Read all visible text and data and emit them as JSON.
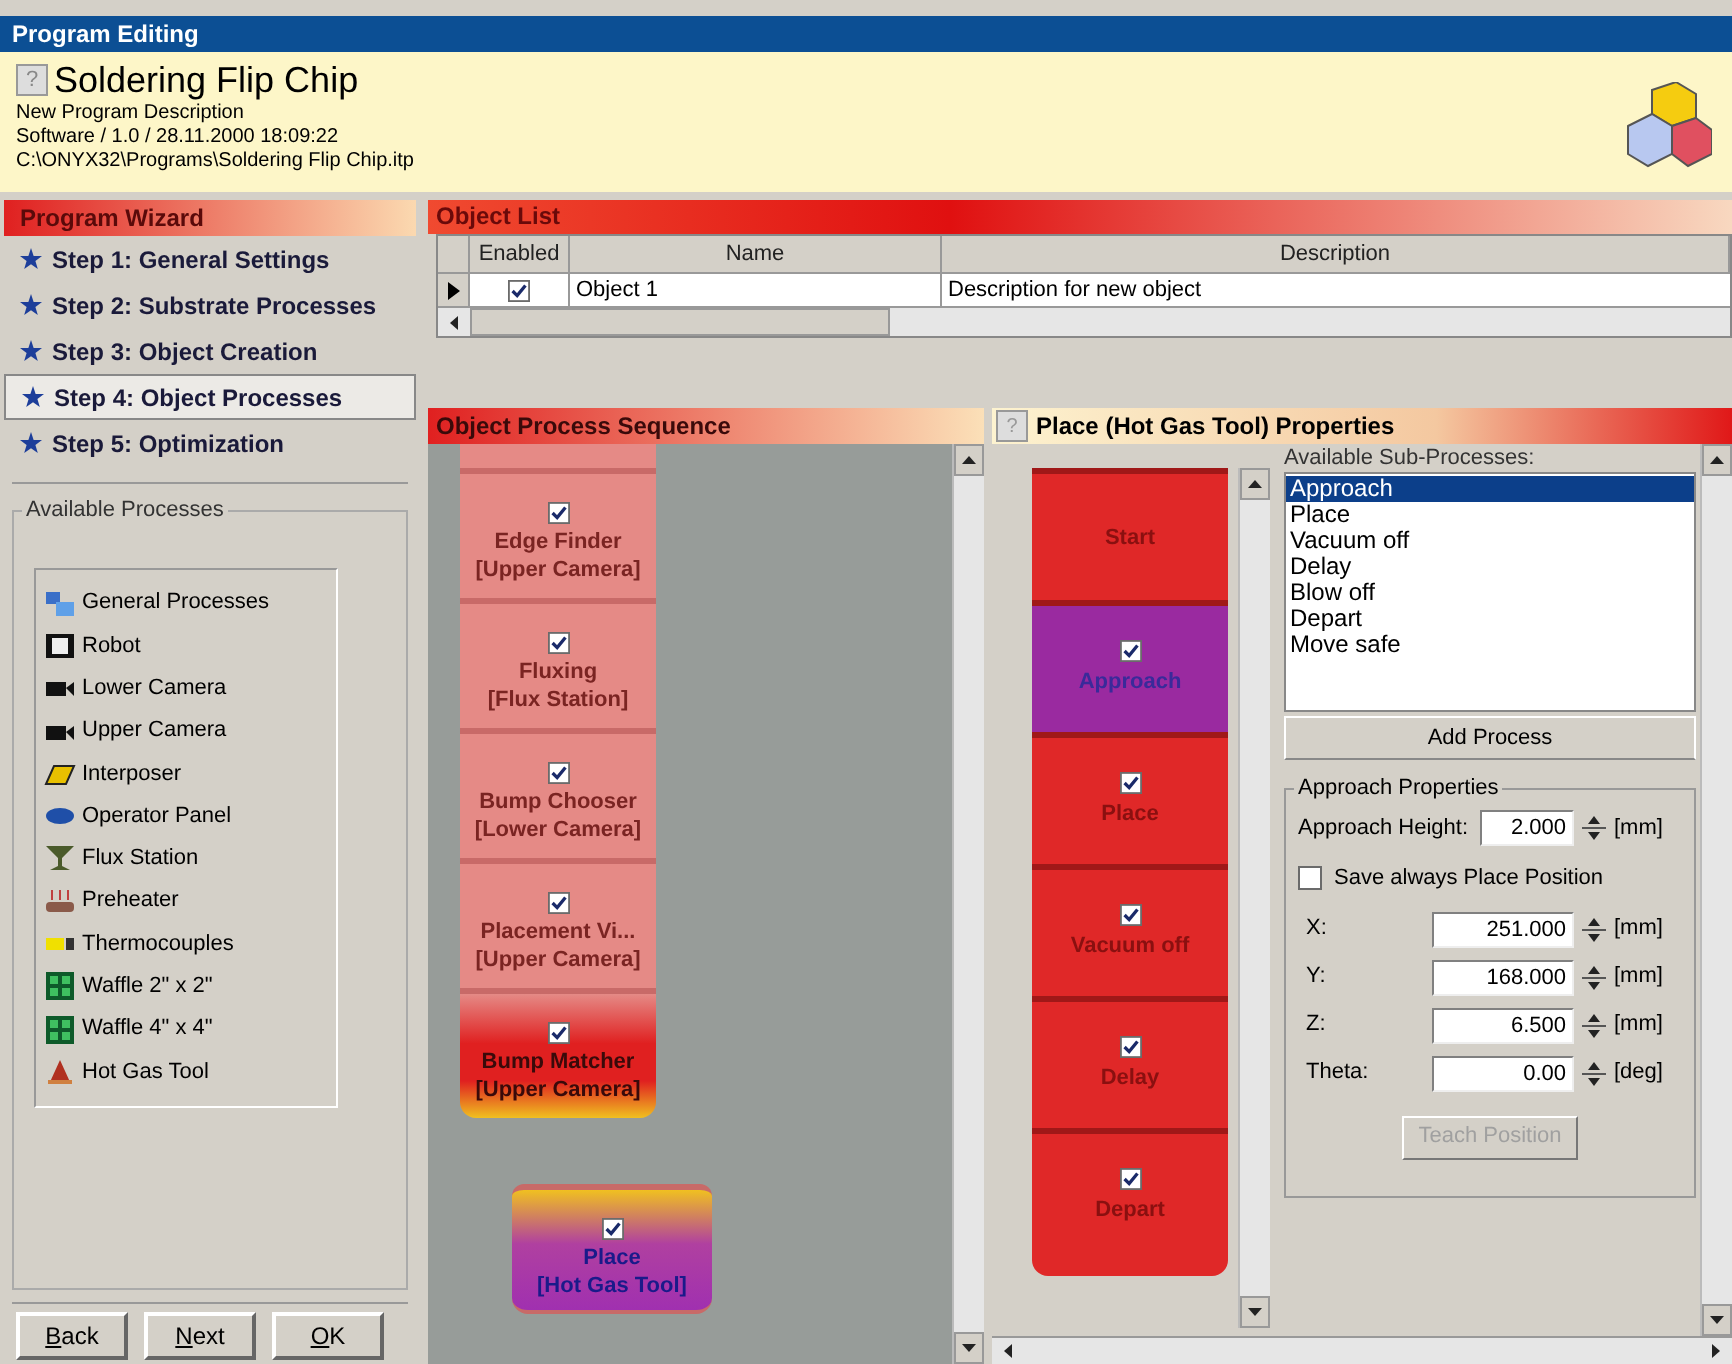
{
  "window": {
    "title": "Program Editing"
  },
  "header": {
    "help_label": "?",
    "title": "Soldering Flip Chip",
    "lines": [
      "New Program Description",
      "Software / 1.0 / 28.11.2000 18:09:22",
      "C:\\ONYX32\\Programs\\Soldering Flip Chip.itp"
    ]
  },
  "wizard": {
    "title": "Program Wizard",
    "steps": [
      {
        "label": "Step 1: General Settings",
        "selected": false
      },
      {
        "label": "Step 2: Substrate Processes",
        "selected": false
      },
      {
        "label": "Step 3: Object Creation",
        "selected": false
      },
      {
        "label": "Step 4: Object Processes",
        "selected": true
      },
      {
        "label": "Step 5: Optimization",
        "selected": false
      }
    ]
  },
  "available_processes": {
    "title": "Available Processes",
    "items": [
      "General Processes",
      "Robot",
      "Lower Camera",
      "Upper Camera",
      "Interposer",
      "Operator Panel",
      "Flux Station",
      "Preheater",
      "Thermocouples",
      "Waffle 2\" x 2\"",
      "Waffle 4\" x 4\"",
      "Hot Gas Tool"
    ]
  },
  "buttons": [
    "Back",
    "Next",
    "OK"
  ],
  "object_list": {
    "title": "Object List",
    "columns": [
      "Enabled",
      "Name",
      "Description"
    ],
    "rows": [
      {
        "selected": true,
        "enabled": true,
        "name": "Object 1",
        "description": "Description for new object"
      }
    ]
  },
  "sequence": {
    "title": "Object Process Sequence",
    "blocks": [
      {
        "kind": "faded",
        "checked": true,
        "label": "Edge Finder",
        "sublabel": "[Upper Camera]"
      },
      {
        "kind": "faded",
        "checked": true,
        "label": "Fluxing",
        "sublabel": "[Flux Station]"
      },
      {
        "kind": "faded",
        "checked": true,
        "label": "Bump Chooser",
        "sublabel": "[Lower Camera]"
      },
      {
        "kind": "faded",
        "checked": true,
        "label": "Placement Vi...",
        "sublabel": "[Upper Camera]"
      },
      {
        "kind": "highlighted",
        "checked": true,
        "label": "Bump Matcher",
        "sublabel": "[Upper Camera]"
      },
      {
        "kind": "dragging",
        "checked": true,
        "label": "Place",
        "sublabel": "[Hot Gas Tool]"
      }
    ]
  },
  "properties": {
    "help_label": "?",
    "title": "Place (Hot Gas Tool) Properties",
    "blocks": [
      {
        "kind": "start",
        "label": "Start"
      },
      {
        "kind": "step",
        "label": "Approach",
        "checked": true,
        "selected": true
      },
      {
        "kind": "step",
        "label": "Place",
        "checked": true,
        "selected": false
      },
      {
        "kind": "step",
        "label": "Vacuum off",
        "checked": true,
        "selected": false
      },
      {
        "kind": "step",
        "label": "Delay",
        "checked": true,
        "selected": false
      },
      {
        "kind": "step",
        "label": "Depart",
        "checked": true,
        "selected": false
      }
    ],
    "available_label": "Available Sub-Processes:",
    "sub_processes": [
      {
        "label": "Approach",
        "selected": true
      },
      {
        "label": "Place",
        "selected": false
      },
      {
        "label": "Vacuum off",
        "selected": false
      },
      {
        "label": "Delay",
        "selected": false
      },
      {
        "label": "Blow off",
        "selected": false
      },
      {
        "label": "Depart",
        "selected": false
      },
      {
        "label": "Move safe",
        "selected": false
      }
    ],
    "add_button": "Add Process",
    "group": {
      "title": "Approach Properties",
      "height": {
        "label": "Approach Height:",
        "value": "2.000",
        "unit": "[mm]"
      },
      "save_position": {
        "label": "Save always Place Position",
        "checked": false
      },
      "fields": [
        {
          "label": "X:",
          "value": "251.000",
          "unit": "[mm]"
        },
        {
          "label": "Y:",
          "value": "168.000",
          "unit": "[mm]"
        },
        {
          "label": "Z:",
          "value": "6.500",
          "unit": "[mm]"
        },
        {
          "label": "Theta:",
          "value": "0.00",
          "unit": "[deg]"
        }
      ],
      "teach_button": {
        "label": "Teach Position",
        "disabled": true
      }
    }
  }
}
